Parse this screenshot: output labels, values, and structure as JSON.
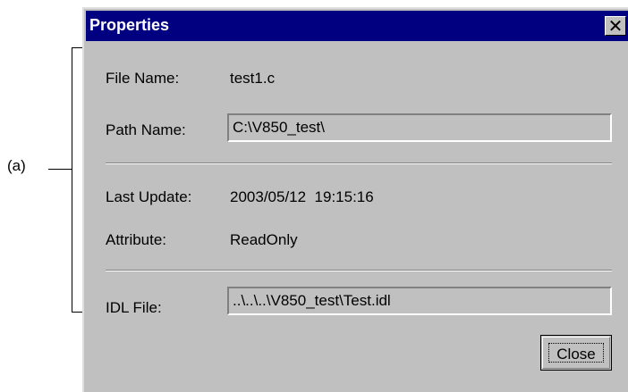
{
  "annotation": {
    "label": "(a)"
  },
  "dialog": {
    "title": "Properties",
    "close_glyph": "✕",
    "file_name": {
      "label": "File Name:",
      "value": "test1.c"
    },
    "path_name": {
      "label": "Path Name:",
      "value": "C:\\V850_test\\"
    },
    "last_update": {
      "label": "Last Update:",
      "value": "2003/05/12  19:15:16"
    },
    "attribute": {
      "label": "Attribute:",
      "value": "ReadOnly"
    },
    "idl_file": {
      "label": "IDL File:",
      "value": "..\\..\\..\\V850_test\\Test.idl"
    },
    "close_button_label": "Close"
  },
  "colors": {
    "titlebar": "#000080",
    "dialog_bg": "#c0c0c0"
  }
}
